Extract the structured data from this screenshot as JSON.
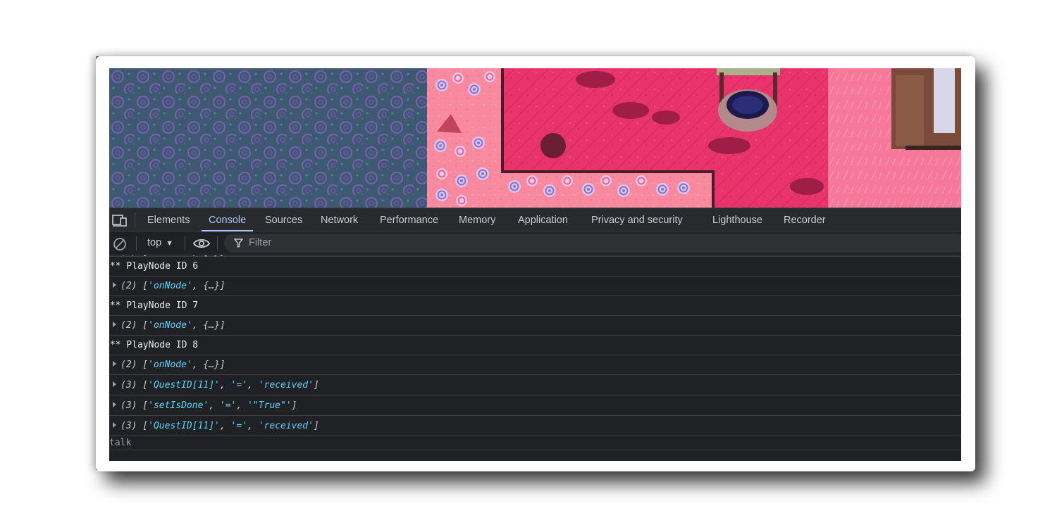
{
  "devtools": {
    "tabs": [
      {
        "label": "Elements",
        "active": false
      },
      {
        "label": "Console",
        "active": true
      },
      {
        "label": "Sources",
        "active": false
      },
      {
        "label": "Network",
        "active": false
      },
      {
        "label": "Performance",
        "active": false
      },
      {
        "label": "Memory",
        "active": false
      },
      {
        "label": "Application",
        "active": false
      },
      {
        "label": "Privacy and security",
        "active": false
      },
      {
        "label": "Lighthouse",
        "active": false
      },
      {
        "label": "Recorder",
        "active": false
      }
    ],
    "icons": {
      "device_toggle": "device-toolbar-icon",
      "clear": "clear-console-icon",
      "eye": "live-expression-icon",
      "filter": "filter-icon"
    },
    "accent_color": "#a8c7fa",
    "string_color": "#5cd5fb"
  },
  "toolbar": {
    "context": "top",
    "context_arrow": "▼",
    "filter_placeholder": "Filter"
  },
  "console": {
    "rows": [
      {
        "type": "array",
        "count": "(2)",
        "items": [
          "'onNode'"
        ],
        "tail": ", {…}]"
      },
      {
        "type": "log",
        "text": "*** PlayNode ID 6"
      },
      {
        "type": "array",
        "count": "(2)",
        "items": [
          "'onNode'"
        ],
        "tail": ", {…}]"
      },
      {
        "type": "log",
        "text": "*** PlayNode ID 7"
      },
      {
        "type": "array",
        "count": "(2)",
        "items": [
          "'onNode'"
        ],
        "tail": ", {…}]"
      },
      {
        "type": "log",
        "text": "*** PlayNode ID 8"
      },
      {
        "type": "array",
        "count": "(2)",
        "items": [
          "'onNode'"
        ],
        "tail": ", {…}]"
      },
      {
        "type": "array",
        "count": "(3)",
        "items": [
          "'QuestID[11]'",
          "'='",
          "'received'"
        ],
        "tail": "]"
      },
      {
        "type": "array",
        "count": "(3)",
        "items": [
          "'setIsDone'",
          "'='",
          "'\"True\"'"
        ],
        "tail": "]"
      },
      {
        "type": "array",
        "count": "(3)",
        "items": [
          "'QuestID[11]'",
          "'='",
          "'received'"
        ],
        "tail": "]"
      },
      {
        "type": "log",
        "text": "talk"
      }
    ]
  }
}
